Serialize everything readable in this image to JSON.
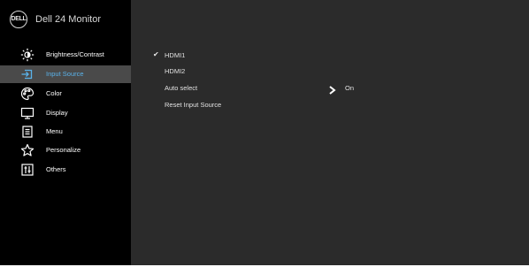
{
  "header": {
    "logo": "DELL",
    "model": "Dell 24 Monitor"
  },
  "menu": [
    {
      "label": "Brightness/Contrast",
      "icon": "brightness-icon",
      "selected": false
    },
    {
      "label": "Input Source",
      "icon": "input-source-icon",
      "selected": true
    },
    {
      "label": "Color",
      "icon": "palette-icon",
      "selected": false
    },
    {
      "label": "Display",
      "icon": "display-icon",
      "selected": false
    },
    {
      "label": "Menu",
      "icon": "menu-icon",
      "selected": false
    },
    {
      "label": "Personalize",
      "icon": "star-icon",
      "selected": false
    },
    {
      "label": "Others",
      "icon": "sliders-icon",
      "selected": false
    }
  ],
  "input_source": {
    "options": [
      {
        "label": "HDMI1",
        "checked": true
      },
      {
        "label": "HDMI2",
        "checked": false
      },
      {
        "label": "Auto select",
        "checked": false
      },
      {
        "label": "Reset Input Source",
        "checked": false
      }
    ],
    "auto_select_value": "On"
  },
  "colors": {
    "sidebar_bg": "#000000",
    "panel_bg": "#2b2b2b",
    "selected_bg": "#4a4a4a",
    "accent": "#5ab2ea"
  }
}
